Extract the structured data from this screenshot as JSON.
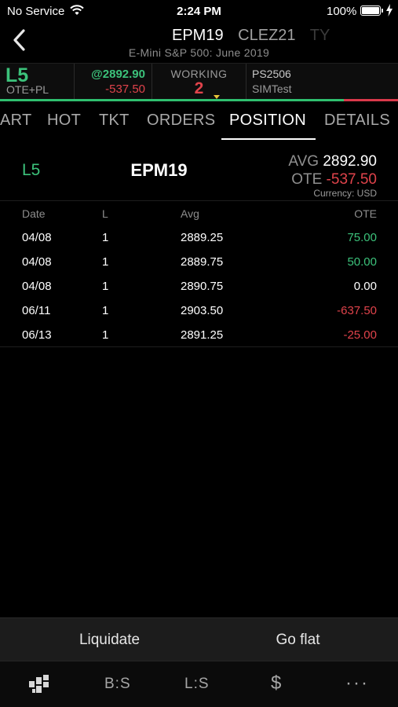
{
  "status_bar": {
    "carrier": "No Service",
    "time": "2:24 PM",
    "battery_percent": "100%",
    "battery_level": 1.0
  },
  "header": {
    "symbols": [
      "EPM19",
      "CLEZ21",
      "TY"
    ],
    "subtitle": "E-Mini S&P 500: June 2019",
    "back_icon": "chevron-left-icon"
  },
  "info_strip": {
    "position": "L5",
    "position_label": "OTE+PL",
    "avg_price": "@2892.90",
    "pl": "-537.50",
    "working_label": "WORKING",
    "working_count": "2",
    "account_id": "PS2506",
    "account_name": "SIMTest",
    "pl_bar_colors": {
      "positive": "#2fbf6f",
      "negative": "#d9394a"
    }
  },
  "section_tabs": {
    "tabs": [
      "ART",
      "HOT",
      "TKT",
      "ORDERS",
      "POSITION",
      "DETAILS"
    ],
    "active": "POSITION"
  },
  "summary": {
    "position": "L5",
    "symbol": "EPM19",
    "avg_label": "AVG",
    "avg_value": "2892.90",
    "ote_label": "OTE",
    "ote_value": "-537.50",
    "currency": "Currency: USD"
  },
  "fills": {
    "columns": [
      "Date",
      "L",
      "Avg",
      "OTE"
    ],
    "rows": [
      {
        "date": "04/08",
        "l": "1",
        "avg": "2889.25",
        "ote": "75.00",
        "sign": "pos"
      },
      {
        "date": "04/08",
        "l": "1",
        "avg": "2889.75",
        "ote": "50.00",
        "sign": "pos"
      },
      {
        "date": "04/08",
        "l": "1",
        "avg": "2890.75",
        "ote": "0.00",
        "sign": "zero"
      },
      {
        "date": "06/11",
        "l": "1",
        "avg": "2903.50",
        "ote": "-637.50",
        "sign": "neg"
      },
      {
        "date": "06/13",
        "l": "1",
        "avg": "2891.25",
        "ote": "-25.00",
        "sign": "neg"
      }
    ]
  },
  "actions": {
    "liquidate": "Liquidate",
    "go_flat": "Go flat"
  },
  "tab_bar": {
    "items": [
      {
        "name": "logo-icon",
        "label": ""
      },
      {
        "name": "tab-buy-sell",
        "label": "B:S"
      },
      {
        "name": "tab-long-short",
        "label": "L:S"
      },
      {
        "name": "tab-dollar",
        "label": "$"
      },
      {
        "name": "tab-more",
        "label": "···"
      }
    ]
  },
  "colors": {
    "green": "#3cc27b",
    "red": "#e0434b",
    "working_caret": "#e8c33a"
  }
}
